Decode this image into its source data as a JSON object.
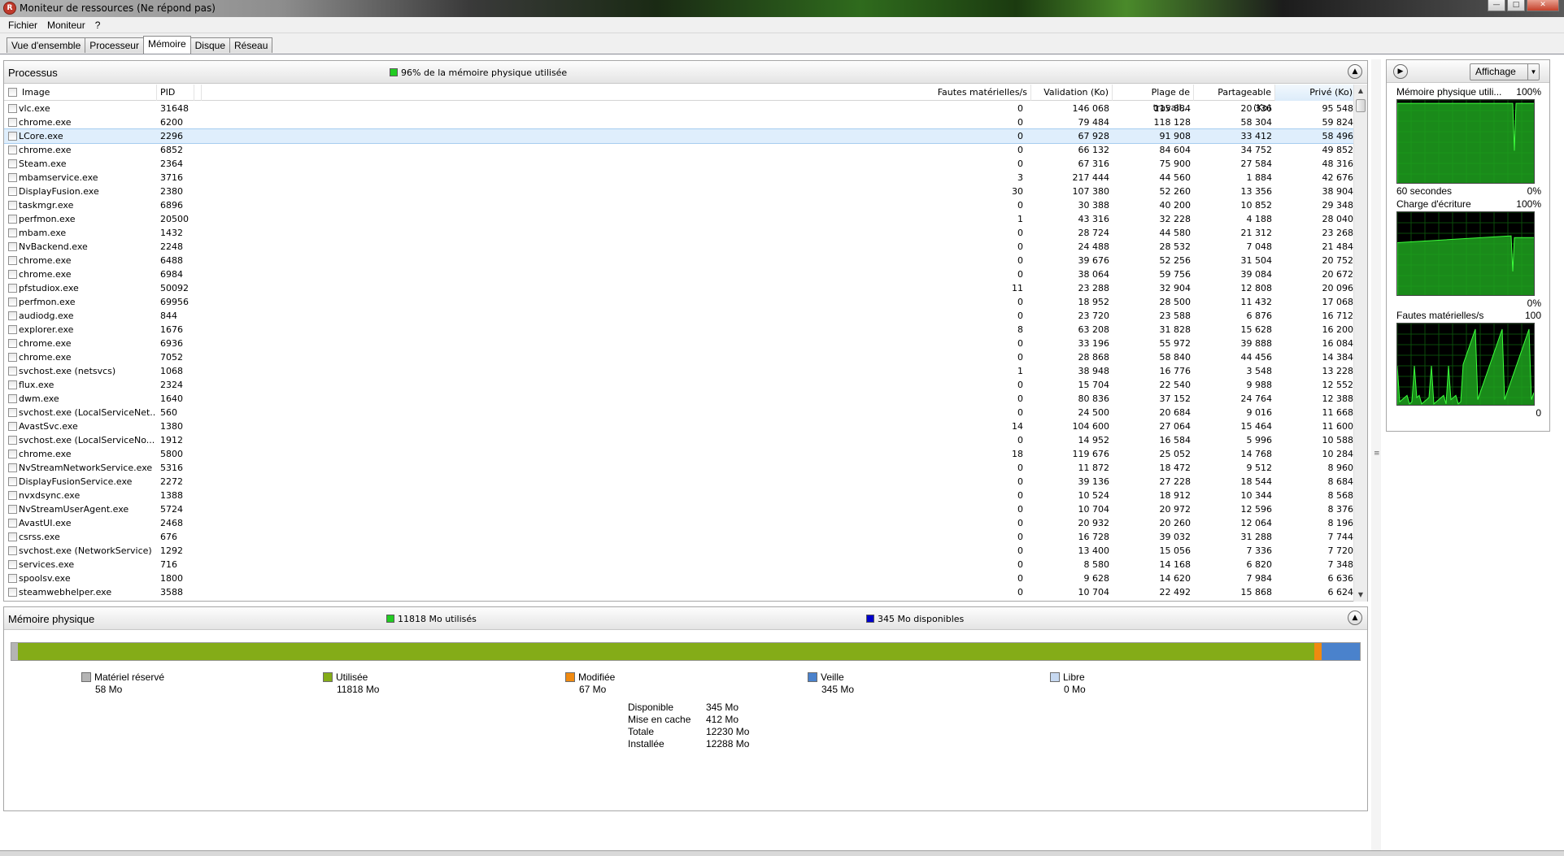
{
  "window": {
    "title": "Moniteur de ressources (Ne répond pas)"
  },
  "menu": [
    "Fichier",
    "Moniteur",
    "?"
  ],
  "tabs": [
    {
      "label": "Vue d'ensemble",
      "active": false
    },
    {
      "label": "Processeur",
      "active": false
    },
    {
      "label": "Mémoire",
      "active": true
    },
    {
      "label": "Disque",
      "active": false
    },
    {
      "label": "Réseau",
      "active": false
    }
  ],
  "processes": {
    "title": "Processus",
    "status": "96% de la mémoire physique utilisée",
    "status_color": "#22cc22",
    "columns": [
      "Image",
      "PID",
      "Fautes matérielles/s",
      "Validation (Ko)",
      "Plage de travail...",
      "Partageable (Ko)",
      "Privé (Ko)"
    ],
    "selected_row": 2,
    "rows": [
      [
        "vlc.exe",
        "31648",
        "0",
        "146 068",
        "115 884",
        "20 336",
        "95 548"
      ],
      [
        "chrome.exe",
        "6200",
        "0",
        "79 484",
        "118 128",
        "58 304",
        "59 824"
      ],
      [
        "LCore.exe",
        "2296",
        "0",
        "67 928",
        "91 908",
        "33 412",
        "58 496"
      ],
      [
        "chrome.exe",
        "6852",
        "0",
        "66 132",
        "84 604",
        "34 752",
        "49 852"
      ],
      [
        "Steam.exe",
        "2364",
        "0",
        "67 316",
        "75 900",
        "27 584",
        "48 316"
      ],
      [
        "mbamservice.exe",
        "3716",
        "3",
        "217 444",
        "44 560",
        "1 884",
        "42 676"
      ],
      [
        "DisplayFusion.exe",
        "2380",
        "30",
        "107 380",
        "52 260",
        "13 356",
        "38 904"
      ],
      [
        "taskmgr.exe",
        "6896",
        "0",
        "30 388",
        "40 200",
        "10 852",
        "29 348"
      ],
      [
        "perfmon.exe",
        "20500",
        "1",
        "43 316",
        "32 228",
        "4 188",
        "28 040"
      ],
      [
        "mbam.exe",
        "1432",
        "0",
        "28 724",
        "44 580",
        "21 312",
        "23 268"
      ],
      [
        "NvBackend.exe",
        "2248",
        "0",
        "24 488",
        "28 532",
        "7 048",
        "21 484"
      ],
      [
        "chrome.exe",
        "6488",
        "0",
        "39 676",
        "52 256",
        "31 504",
        "20 752"
      ],
      [
        "chrome.exe",
        "6984",
        "0",
        "38 064",
        "59 756",
        "39 084",
        "20 672"
      ],
      [
        "pfstudiox.exe",
        "50092",
        "11",
        "23 288",
        "32 904",
        "12 808",
        "20 096"
      ],
      [
        "perfmon.exe",
        "69956",
        "0",
        "18 952",
        "28 500",
        "11 432",
        "17 068"
      ],
      [
        "audiodg.exe",
        "844",
        "0",
        "23 720",
        "23 588",
        "6 876",
        "16 712"
      ],
      [
        "explorer.exe",
        "1676",
        "8",
        "63 208",
        "31 828",
        "15 628",
        "16 200"
      ],
      [
        "chrome.exe",
        "6936",
        "0",
        "33 196",
        "55 972",
        "39 888",
        "16 084"
      ],
      [
        "chrome.exe",
        "7052",
        "0",
        "28 868",
        "58 840",
        "44 456",
        "14 384"
      ],
      [
        "svchost.exe (netsvcs)",
        "1068",
        "1",
        "38 948",
        "16 776",
        "3 548",
        "13 228"
      ],
      [
        "flux.exe",
        "2324",
        "0",
        "15 704",
        "22 540",
        "9 988",
        "12 552"
      ],
      [
        "dwm.exe",
        "1640",
        "0",
        "80 836",
        "37 152",
        "24 764",
        "12 388"
      ],
      [
        "svchost.exe (LocalServiceNet...",
        "560",
        "0",
        "24 500",
        "20 684",
        "9 016",
        "11 668"
      ],
      [
        "AvastSvc.exe",
        "1380",
        "14",
        "104 600",
        "27 064",
        "15 464",
        "11 600"
      ],
      [
        "svchost.exe (LocalServiceNo...",
        "1912",
        "0",
        "14 952",
        "16 584",
        "5 996",
        "10 588"
      ],
      [
        "chrome.exe",
        "5800",
        "18",
        "119 676",
        "25 052",
        "14 768",
        "10 284"
      ],
      [
        "NvStreamNetworkService.exe",
        "5316",
        "0",
        "11 872",
        "18 472",
        "9 512",
        "8 960"
      ],
      [
        "DisplayFusionService.exe",
        "2272",
        "0",
        "39 136",
        "27 228",
        "18 544",
        "8 684"
      ],
      [
        "nvxdsync.exe",
        "1388",
        "0",
        "10 524",
        "18 912",
        "10 344",
        "8 568"
      ],
      [
        "NvStreamUserAgent.exe",
        "5724",
        "0",
        "10 704",
        "20 972",
        "12 596",
        "8 376"
      ],
      [
        "AvastUI.exe",
        "2468",
        "0",
        "20 932",
        "20 260",
        "12 064",
        "8 196"
      ],
      [
        "csrss.exe",
        "676",
        "0",
        "16 728",
        "39 032",
        "31 288",
        "7 744"
      ],
      [
        "svchost.exe (NetworkService)",
        "1292",
        "0",
        "13 400",
        "15 056",
        "7 336",
        "7 720"
      ],
      [
        "services.exe",
        "716",
        "0",
        "8 580",
        "14 168",
        "6 820",
        "7 348"
      ],
      [
        "spoolsv.exe",
        "1800",
        "0",
        "9 628",
        "14 620",
        "7 984",
        "6 636"
      ],
      [
        "steamwebhelper.exe",
        "3588",
        "0",
        "10 704",
        "22 492",
        "15 868",
        "6 624"
      ]
    ]
  },
  "memory": {
    "title": "Mémoire physique",
    "used_label": "11818 Mo utilisés",
    "used_color": "#22cc22",
    "available_label": "345 Mo disponibles",
    "available_color": "#0000cc",
    "bar": [
      {
        "name": "Matériel réservé",
        "value": 58,
        "color": "#b4b4b4"
      },
      {
        "name": "Utilisée",
        "value": 11818,
        "color": "#84ac18"
      },
      {
        "name": "Modifiée",
        "value": 67,
        "color": "#f08a10"
      },
      {
        "name": "Veille",
        "value": 345,
        "color": "#4a82cc"
      },
      {
        "name": "Libre",
        "value": 0,
        "color": "#c6d8f0"
      }
    ],
    "legend": [
      {
        "label": "Matériel réservé",
        "value": "58 Mo",
        "color": "#b4b4b4"
      },
      {
        "label": "Utilisée",
        "value": "11818 Mo",
        "color": "#84ac18"
      },
      {
        "label": "Modifiée",
        "value": "67 Mo",
        "color": "#f08a10"
      },
      {
        "label": "Veille",
        "value": "345 Mo",
        "color": "#4a82cc"
      },
      {
        "label": "Libre",
        "value": "0 Mo",
        "color": "#c6d8f0"
      }
    ],
    "summary": [
      {
        "label": "Disponible",
        "value": "345 Mo"
      },
      {
        "label": "Mise en cache",
        "value": "412 Mo"
      },
      {
        "label": "Totale",
        "value": "12230 Mo"
      },
      {
        "label": "Installée",
        "value": "12288 Mo"
      }
    ]
  },
  "graphs": {
    "view_button": "Affichage",
    "items": [
      {
        "title": "Mémoire physique utili...",
        "max": "100%",
        "foot_left": "60 secondes",
        "foot_right": "0%",
        "level": 0.96
      },
      {
        "title": "Charge d'écriture",
        "max": "100%",
        "foot_left": "",
        "foot_right": "0%",
        "level": 0.68
      },
      {
        "title": "Fautes matérielles/s",
        "max": "100",
        "foot_left": "",
        "foot_right": "0",
        "level": 0.2
      }
    ]
  }
}
